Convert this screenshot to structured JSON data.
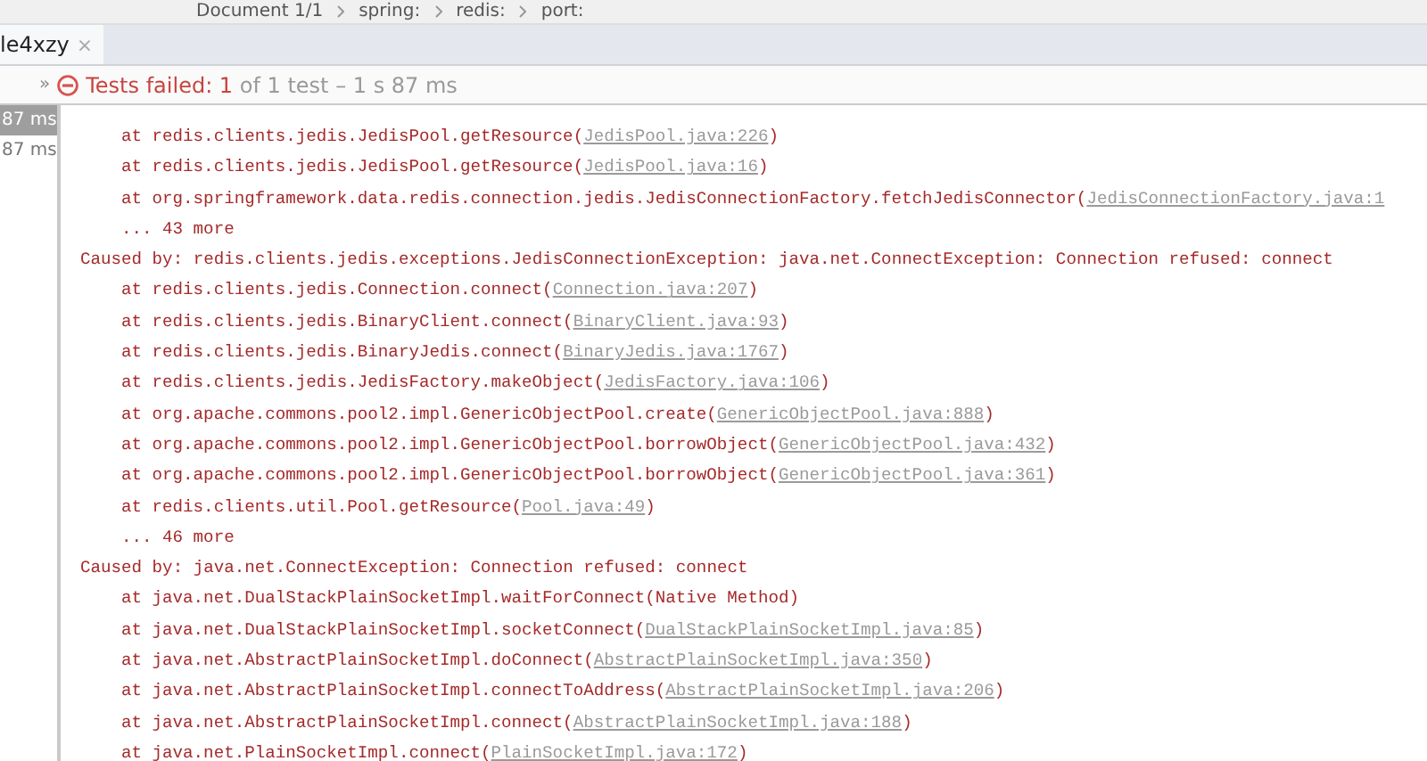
{
  "breadcrumb": [
    "Document 1/1",
    "spring:",
    "redis:",
    "port:"
  ],
  "tabs": [
    {
      "label": "le4xzy",
      "close": "×",
      "selected": true
    }
  ],
  "toolbar": {
    "expand": "»",
    "status": {
      "label": "Tests failed:",
      "count": "1",
      "detail": "of 1 test – 1 s 87 ms"
    }
  },
  "tests": [
    {
      "time": "87 ms",
      "selected": true
    },
    {
      "time": "87 ms",
      "selected": false
    }
  ],
  "console": [
    {
      "kind": "frame",
      "text": "at redis.clients.jedis.JedisPool.getResource(",
      "link": "JedisPool.java:226",
      "end": ")"
    },
    {
      "kind": "frame",
      "text": "at redis.clients.jedis.JedisPool.getResource(",
      "link": "JedisPool.java:16",
      "end": ")"
    },
    {
      "kind": "frame",
      "text": "at org.springframework.data.redis.connection.jedis.JedisConnectionFactory.fetchJedisConnector(",
      "link": "JedisConnectionFactory.java:1"
    },
    {
      "kind": "more",
      "text": "... 43 more"
    },
    {
      "kind": "cause",
      "text": "Caused by: redis.clients.jedis.exceptions.JedisConnectionException: java.net.ConnectException: Connection refused: connect"
    },
    {
      "kind": "frame",
      "text": "at redis.clients.jedis.Connection.connect(",
      "link": "Connection.java:207",
      "end": ")"
    },
    {
      "kind": "frame",
      "text": "at redis.clients.jedis.BinaryClient.connect(",
      "link": "BinaryClient.java:93",
      "end": ")"
    },
    {
      "kind": "frame",
      "text": "at redis.clients.jedis.BinaryJedis.connect(",
      "link": "BinaryJedis.java:1767",
      "end": ")"
    },
    {
      "kind": "frame",
      "text": "at redis.clients.jedis.JedisFactory.makeObject(",
      "link": "JedisFactory.java:106",
      "end": ")"
    },
    {
      "kind": "frame",
      "text": "at org.apache.commons.pool2.impl.GenericObjectPool.create(",
      "link": "GenericObjectPool.java:888",
      "end": ")"
    },
    {
      "kind": "frame",
      "text": "at org.apache.commons.pool2.impl.GenericObjectPool.borrowObject(",
      "link": "GenericObjectPool.java:432",
      "end": ")"
    },
    {
      "kind": "frame",
      "text": "at org.apache.commons.pool2.impl.GenericObjectPool.borrowObject(",
      "link": "GenericObjectPool.java:361",
      "end": ")"
    },
    {
      "kind": "frame",
      "text": "at redis.clients.util.Pool.getResource(",
      "link": "Pool.java:49",
      "end": ")"
    },
    {
      "kind": "more",
      "text": "... 46 more"
    },
    {
      "kind": "cause",
      "text": "Caused by: java.net.ConnectException: Connection refused: connect"
    },
    {
      "kind": "frame",
      "text": "at java.net.DualStackPlainSocketImpl.waitForConnect(Native Method)"
    },
    {
      "kind": "frame",
      "text": "at java.net.DualStackPlainSocketImpl.socketConnect(",
      "link": "DualStackPlainSocketImpl.java:85",
      "end": ")"
    },
    {
      "kind": "frame",
      "text": "at java.net.AbstractPlainSocketImpl.doConnect(",
      "link": "AbstractPlainSocketImpl.java:350",
      "end": ")"
    },
    {
      "kind": "frame",
      "text": "at java.net.AbstractPlainSocketImpl.connectToAddress(",
      "link": "AbstractPlainSocketImpl.java:206",
      "end": ")"
    },
    {
      "kind": "frame",
      "text": "at java.net.AbstractPlainSocketImpl.connect(",
      "link": "AbstractPlainSocketImpl.java:188",
      "end": ")"
    },
    {
      "kind": "frame",
      "text": "at java.net.PlainSocketImpl.connect(",
      "link": "PlainSocketImpl.java:172",
      "end": ")"
    }
  ]
}
